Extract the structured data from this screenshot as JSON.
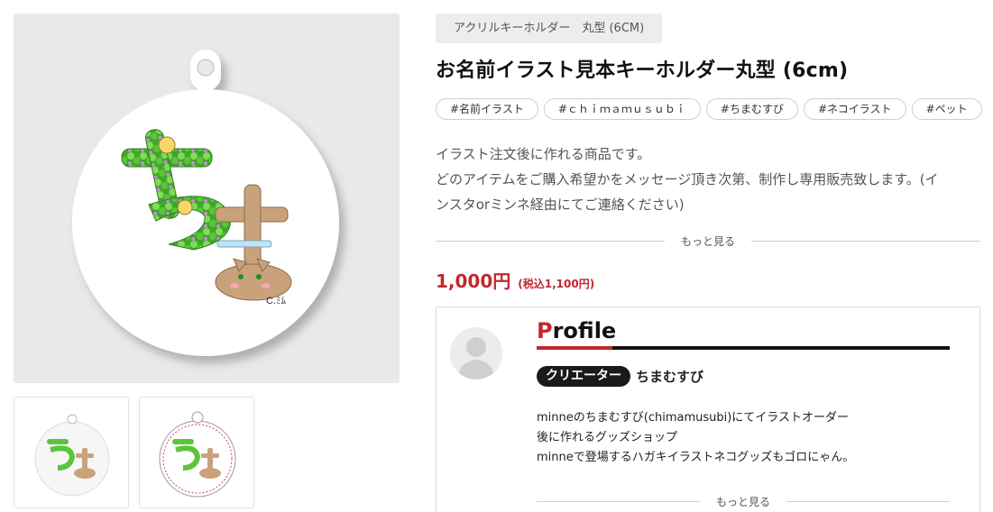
{
  "gallery": {
    "main_image": {
      "description": "round acrylic keyholder with green flower letter and cat letter illustration",
      "signature": "C.ﾐﾑ",
      "art_glyphs": [
        "ち",
        "ま"
      ]
    },
    "thumbnails": [
      {
        "name": "thumbnail-keyholder-front"
      },
      {
        "name": "thumbnail-keyholder-outline"
      }
    ]
  },
  "product": {
    "category": "アクリルキーホルダー　丸型 (6CM)",
    "title": "お名前イラスト見本キーホルダー丸型 (6cm)",
    "tags": [
      "#名前イラスト",
      "#ｃｈｉｍａｍｕｓｕｂｉ",
      "#ちまむすび",
      "#ネコイラスト",
      "#ペット"
    ],
    "description_lines": [
      "イラスト注文後に作れる商品です。",
      "どのアイテムをご購入希望かをメッセージ頂き次第、制作し専用販売致します。(イ",
      "ンスタorミンネ経由にてご連絡ください)"
    ],
    "more_label": "もっと見る",
    "price": "1,000円",
    "price_tax": "(税込1,100円)"
  },
  "profile": {
    "heading_first": "P",
    "heading_rest": "rofile",
    "creator_label": "クリエーター",
    "creator_name": "ちまむすび",
    "bio_lines": [
      "minneのちまむすび(chimamusubi)にてイラストオーダー",
      "後に作れるグッズショップ",
      "minneで登場するハガキイラストネコグッズもゴロにゃん。"
    ],
    "more_label": "もっと見る"
  },
  "colors": {
    "accent_red": "#c0282d",
    "leaf_green": "#5cc43c",
    "cat_tan": "#c9a27c"
  },
  "icons": {
    "avatar": "default-user-silhouette-icon",
    "keyring": "keyring-hole-icon"
  }
}
